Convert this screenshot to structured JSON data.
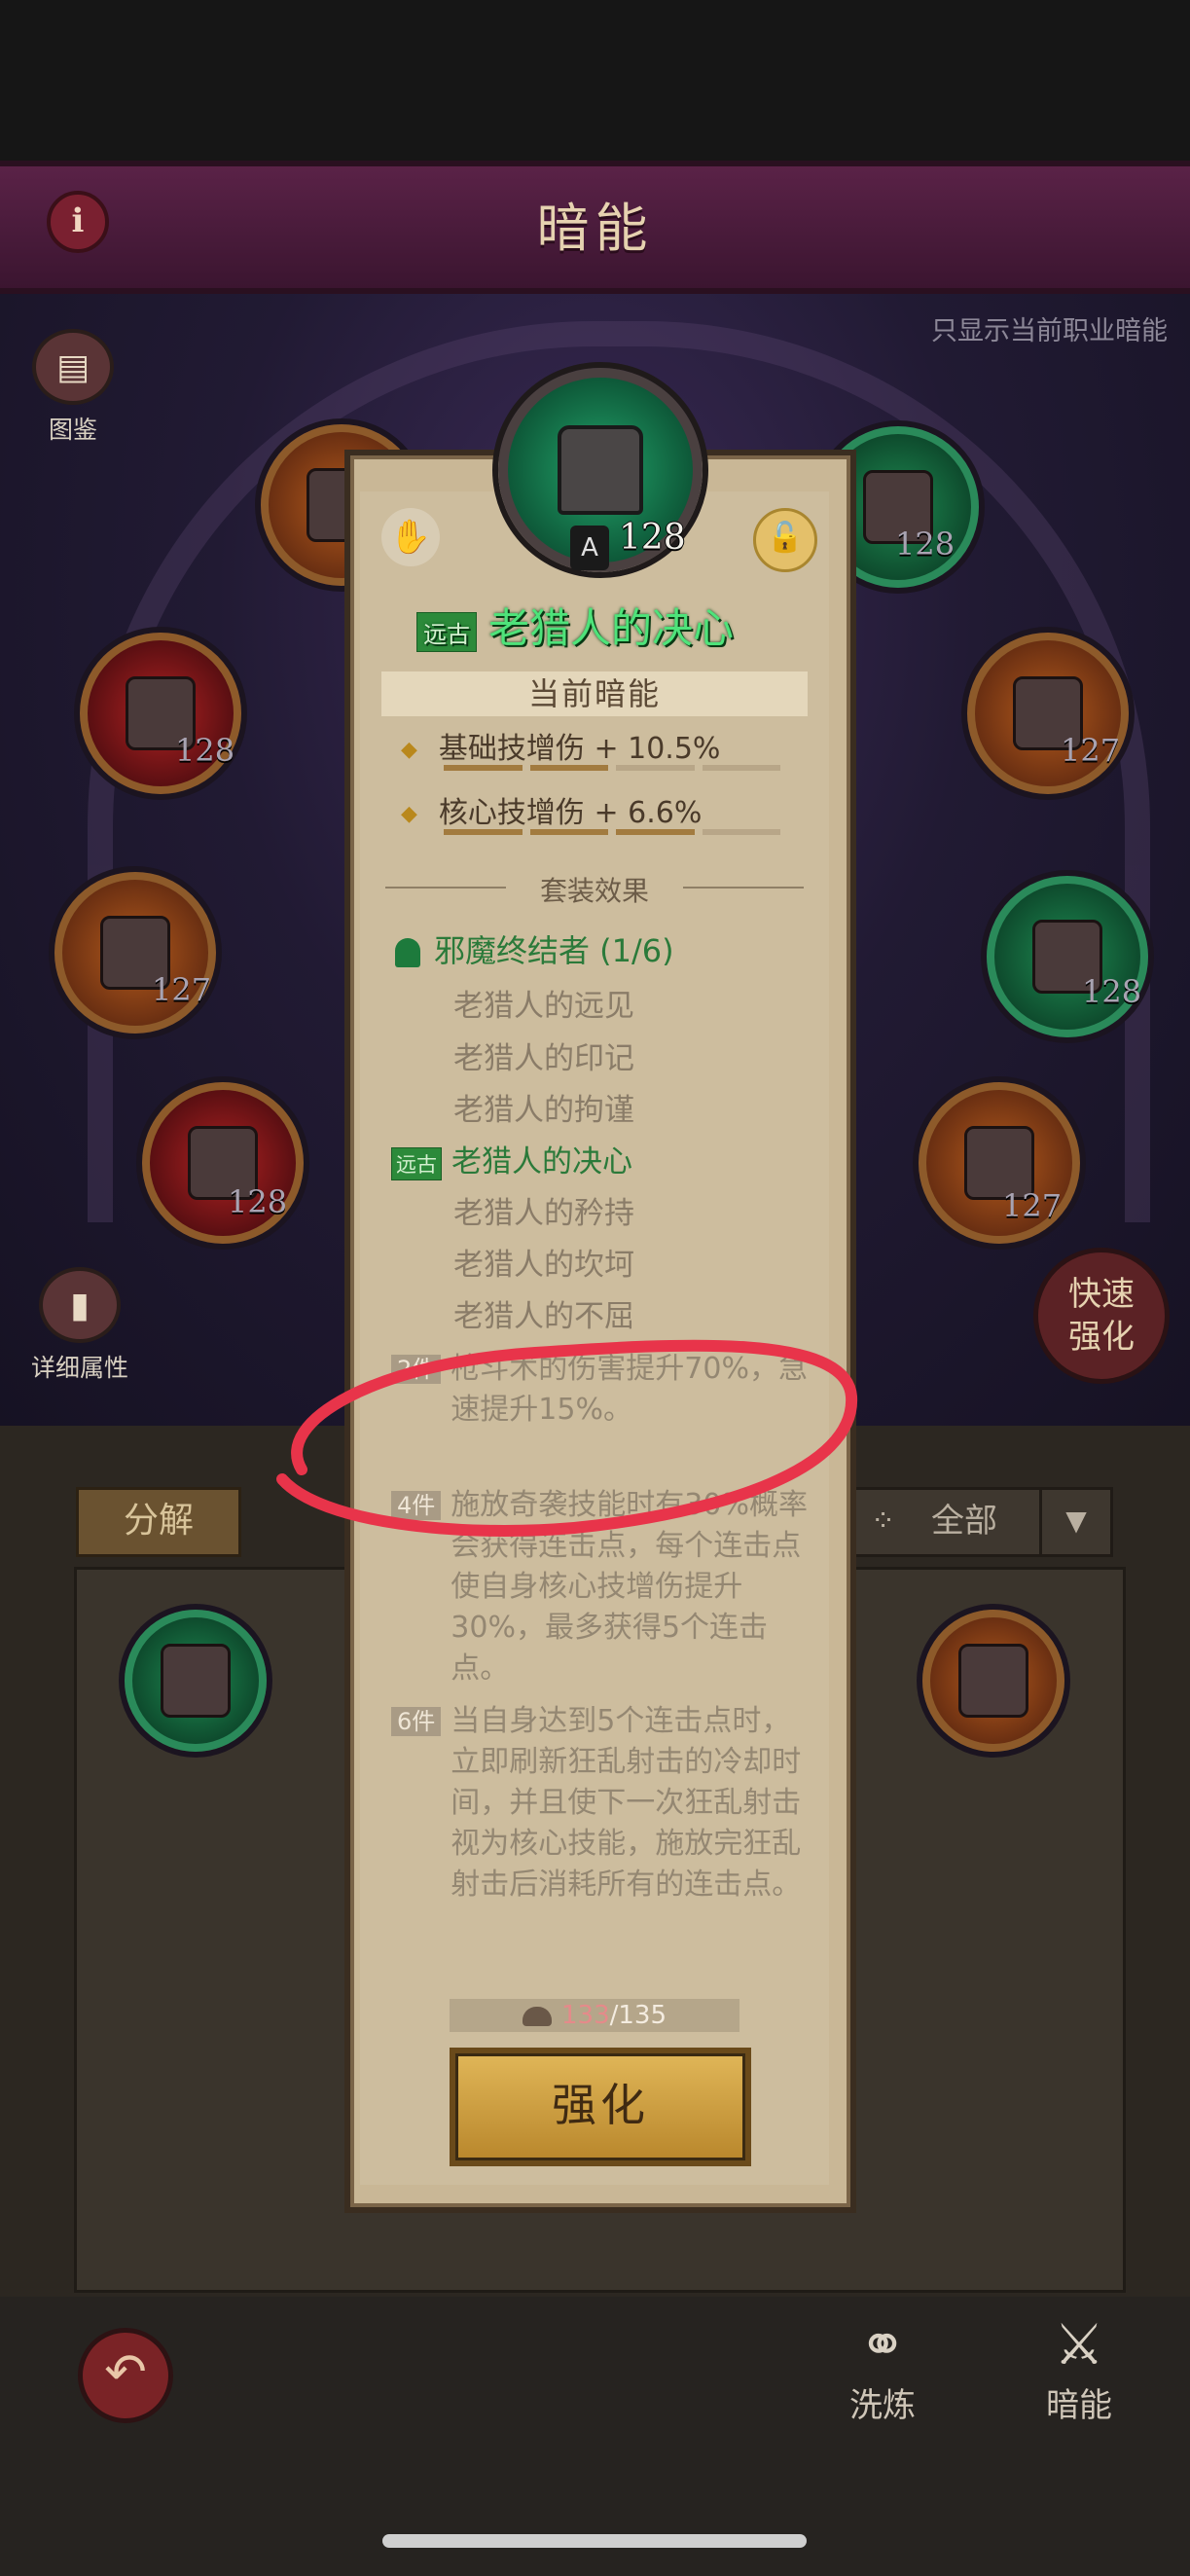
{
  "header": {
    "title": "暗能"
  },
  "filter_hint": "只显示当前职业暗能",
  "side": {
    "codex": "图鉴",
    "detail_attrs": "详细属性",
    "quick_enhance": "快速强化"
  },
  "slots": [
    {
      "id": "s1",
      "level": ""
    },
    {
      "id": "s2",
      "level": "128"
    },
    {
      "id": "s3",
      "level": "128"
    },
    {
      "id": "s4",
      "level": "127"
    },
    {
      "id": "s5",
      "level": "127"
    },
    {
      "id": "s6",
      "level": "128"
    },
    {
      "id": "s7",
      "level": "128"
    },
    {
      "id": "s8",
      "level": "127"
    }
  ],
  "list": {
    "decompose": "分解",
    "filter": "全部"
  },
  "nav": {
    "refine": "洗炼",
    "dark_energy": "暗能"
  },
  "item": {
    "rarity": "远古",
    "name": "老猎人的决心",
    "level": "128",
    "current_header": "当前暗能",
    "stats": [
      {
        "text": "基础技增伤 + 10.5%"
      },
      {
        "text": "核心技增伤 + 6.6%"
      }
    ],
    "set_section": "套装效果",
    "set_name": "邪魔终结者 (1/6)",
    "pieces": [
      "老猎人的远见",
      "老猎人的印记",
      "老猎人的拘谨",
      "老猎人的决心",
      "老猎人的矜持",
      "老猎人的坎坷",
      "老猎人的不屈"
    ],
    "bonuses": [
      {
        "count": "2件",
        "text": "枪斗术的伤害提升70%，急速提升15%。"
      },
      {
        "count": "4件",
        "text": "施放奇袭技能时有30%概率会获得连击点，每个连击点使自身核心技增伤提升30%，最多获得5个连击点。"
      },
      {
        "count": "6件",
        "text": "当自身达到5个连击点时，立即刷新狂乱射击的冷却时间，并且使下一次狂乱射击视为核心技能，施放完狂乱射击后消耗所有的连击点。"
      }
    ],
    "cost_current": "133",
    "cost_total": "/135",
    "enhance": "强化"
  },
  "colors": {
    "accent_green": "#4ee37a",
    "header": "#5a2247",
    "annotation": "#e8344a"
  }
}
